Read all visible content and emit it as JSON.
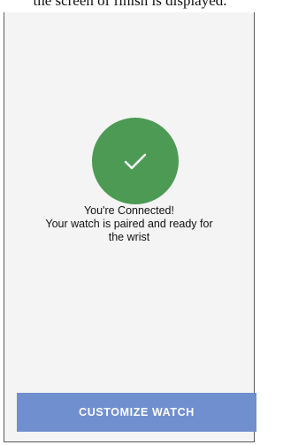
{
  "caption": "the screen of finish is displayed.",
  "success": {
    "title": "You're Connected!",
    "line2": "Your watch is paired and ready for",
    "line3": "the wrist"
  },
  "actions": {
    "customize_label": "CUSTOMIZE WATCH"
  },
  "icons": {
    "status_icon": "checkmark-icon"
  },
  "colors": {
    "success_green": "#4c9a53",
    "button_blue": "#6f8fcf",
    "screen_background": "#f4f4f4"
  }
}
